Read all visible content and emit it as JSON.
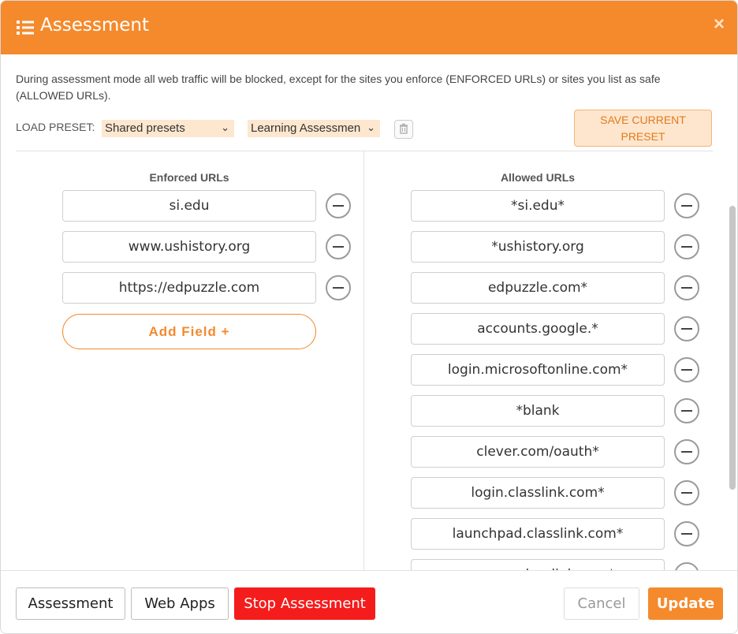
{
  "header": {
    "title": "Assessment",
    "close_label": "×"
  },
  "intro": "During assessment mode all web traffic will be blocked, except for the sites you enforce (ENFORCED URLs) or sites you list as safe (ALLOWED URLs).",
  "preset": {
    "label": "LOAD PRESET:",
    "source_value": "Shared presets",
    "preset_value": "Learning Assessmen",
    "save_label_1": "SAVE CURRENT",
    "save_label_2": "PRESET"
  },
  "enforced": {
    "heading": "Enforced URLs",
    "urls": [
      "si.edu",
      "www.ushistory.org",
      "https://edpuzzle.com"
    ],
    "add_label": "Add Field +"
  },
  "allowed": {
    "heading": "Allowed URLs",
    "urls": [
      "*si.edu*",
      "*ushistory.org",
      "edpuzzle.com*",
      "accounts.google.*",
      "login.microsoftonline.com*",
      "*blank",
      "clever.com/oauth*",
      "login.classlink.com*",
      "launchpad.classlink.com*",
      "myapps.classlink.com*"
    ]
  },
  "footer": {
    "assessment": "Assessment",
    "web_apps": "Web Apps",
    "stop": "Stop Assessment",
    "cancel": "Cancel",
    "update": "Update"
  },
  "colors": {
    "accent": "#f48a2c",
    "danger": "#f51c1c"
  }
}
